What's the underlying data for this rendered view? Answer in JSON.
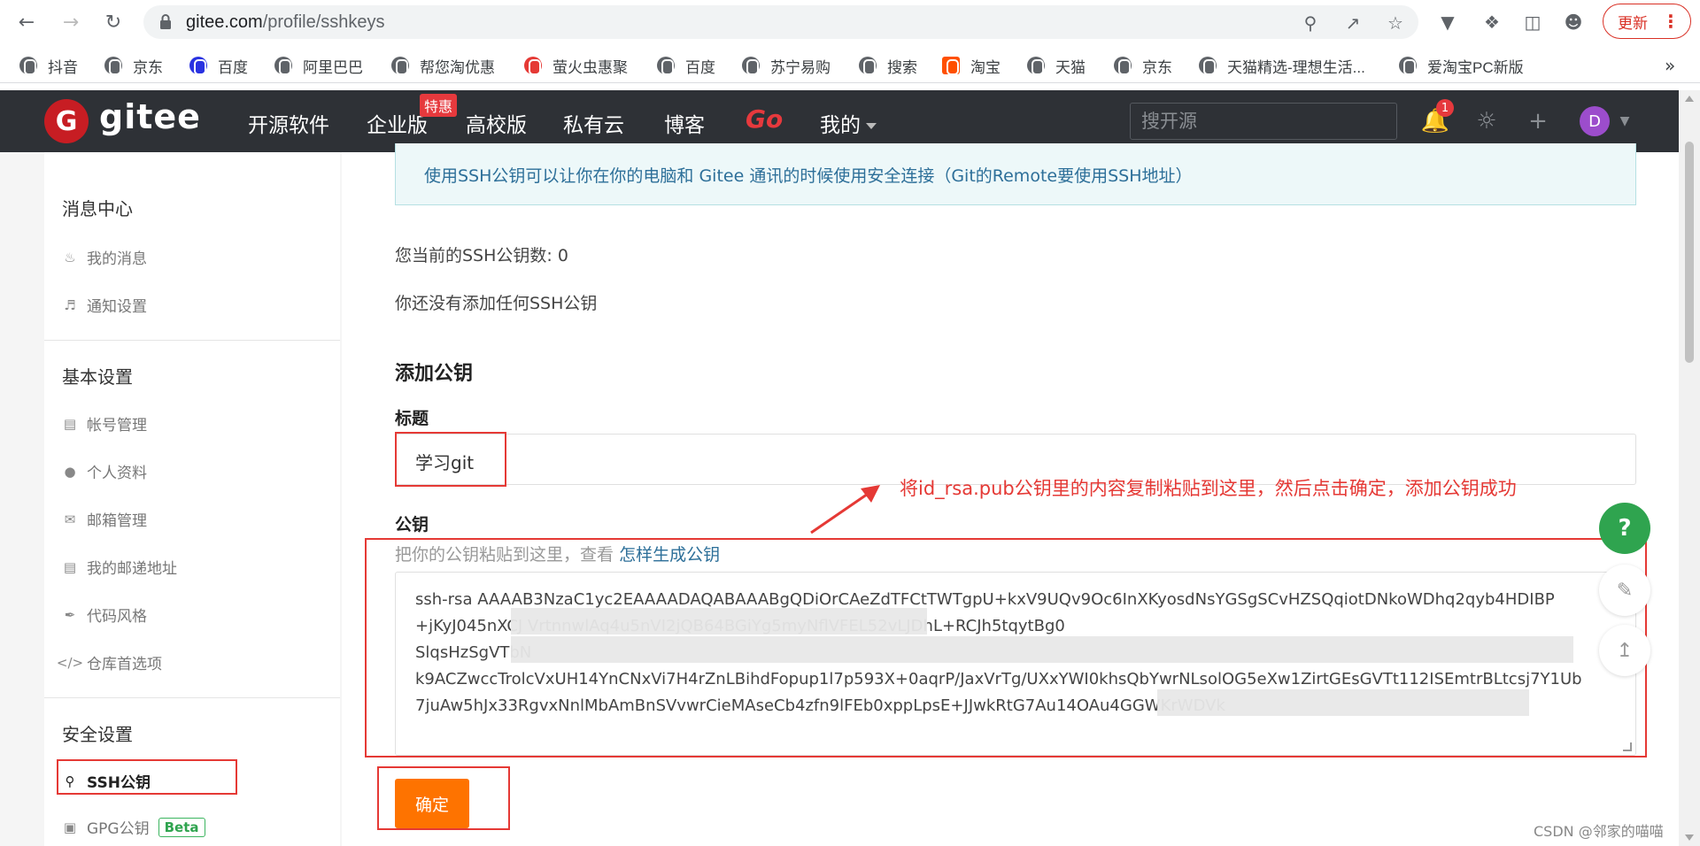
{
  "browser": {
    "url_host": "gitee.com",
    "url_path": "/profile/sshkeys",
    "update_label": "更新",
    "bookmarks": [
      "抖音",
      "京东",
      "百度",
      "阿里巴巴",
      "帮您淘优惠",
      "萤火虫惠聚",
      "百度",
      "苏宁易购",
      "搜索",
      "淘宝",
      "天猫",
      "京东",
      "天猫精选-理想生活...",
      "爱淘宝PC新版"
    ],
    "bookmarks_more": "»"
  },
  "header": {
    "logo_letter": "G",
    "logo_text": "gitee",
    "nav": [
      "开源软件",
      "企业版",
      "高校版",
      "私有云",
      "博客",
      "Go",
      "我的"
    ],
    "special_badge": "特惠",
    "search_placeholder": "搜开源",
    "notification_count": "1",
    "avatar_letter": "D"
  },
  "sidebar": {
    "sections": [
      {
        "title": "消息中心",
        "items": [
          {
            "label": "我的消息",
            "icon": "bell-icon"
          },
          {
            "label": "通知设置",
            "icon": "speaker-icon"
          }
        ]
      },
      {
        "title": "基本设置",
        "items": [
          {
            "label": "帐号管理",
            "icon": "id-card-icon"
          },
          {
            "label": "个人资料",
            "icon": "user-icon"
          },
          {
            "label": "邮箱管理",
            "icon": "mail-icon"
          },
          {
            "label": "我的邮递地址",
            "icon": "address-card-icon"
          },
          {
            "label": "代码风格",
            "icon": "brush-icon"
          },
          {
            "label": "仓库首选项",
            "icon": "code-icon"
          }
        ]
      },
      {
        "title": "安全设置",
        "items": [
          {
            "label": "SSH公钥",
            "icon": "key-icon"
          },
          {
            "label": "GPG公钥",
            "icon": "lock-icon",
            "badge": "Beta"
          }
        ]
      }
    ]
  },
  "main": {
    "info": "使用SSH公钥可以让你在你的电脑和 Gitee 通讯的时候使用安全连接（Git的Remote要使用SSH地址）",
    "key_count": "您当前的SSH公钥数: 0",
    "no_keys": "你还没有添加任何SSH公钥",
    "add_title": "添加公钥",
    "title_label": "标题",
    "title_value": "学习git",
    "key_label": "公钥",
    "hint_prefix": "把你的公钥粘贴到这里，查看",
    "hint_link": "怎样生成公钥",
    "key_lines": [
      "ssh-rsa AAAAB3NzaC1yc2EAAAADAQABAAABgQDiOrCAeZdTFCtTWTgpU+kxV9UQv9Oc6InXKyosdNsYGSgSCvHZSQqiotDNkoWDhq2qyb4HDIBP",
      "+jKyJ045nXCJ                                              VrtnnwlAq4u5nVI2jQB64BGiYg5myNflVFEL52vLJDhL+RCJh5tqytBg0",
      "SlqsHzSgVTbN                                                                                                  ",
      "k9ACZwccTrolcVxUH14YnCNxVi7H4rZnLBihdFopup1l7p593X+0aqrP/JaxVrTg/UXxYWI0khsQbYwrNLsolOG5eXw1ZirtGEsGVTt112ISEmtrBLtcsj7Y1Ub",
      "7juAw5hJx33RgvxNnlMbAmBnSVvwrCieMAseCb4zfn9lFEb0xppLpsE+JJwkRtG7Au14OAu4GGWKrWDVk"
    ],
    "confirm_label": "确定"
  },
  "annotation": {
    "text": "将id_rsa.pub公钥里的内容复制粘贴到这里，然后点击确定，添加公钥成功"
  },
  "widgets": {
    "help_label": "?"
  },
  "watermark": "CSDN @邻家的喵喵"
}
